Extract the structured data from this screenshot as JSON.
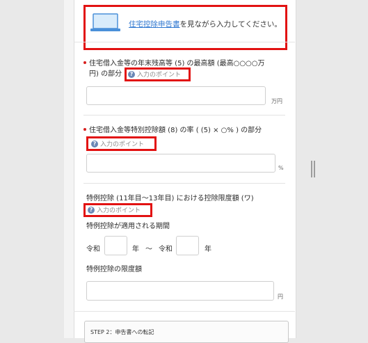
{
  "banner": {
    "link": "住宅控除申告書",
    "rest": "を見ながら入力してください。"
  },
  "sections": [
    {
      "label_line1": "住宅借入金等の年末残高等 (5) の最高額 (最高○○○○万",
      "label_line2": "円) の部分",
      "point": "入力のポイント",
      "unit": "万円"
    },
    {
      "label_line1": "住宅借入金等特別控除額 (8) の率 ( (5) × ○% ) の部分",
      "point": "入力のポイント",
      "unit": "%"
    },
    {
      "label_line1": "特例控除 (11年目～13年目) における控除限度額 (ワ)",
      "point": "入力のポイント",
      "period_label": "特例控除が適用される期間",
      "era1": "令和",
      "year1": "年",
      "tilde": "～",
      "era2": "令和",
      "year2": "年",
      "limit_label": "特例控除の限度額",
      "unit": "円"
    }
  ],
  "step": {
    "text": "STEP 2：申告書への転記"
  },
  "icons": {
    "question": "?",
    "laptop": "laptop-icon"
  },
  "colors": {
    "red_frame": "#e21212",
    "link": "#2f77d0",
    "required": "#d8201f"
  }
}
